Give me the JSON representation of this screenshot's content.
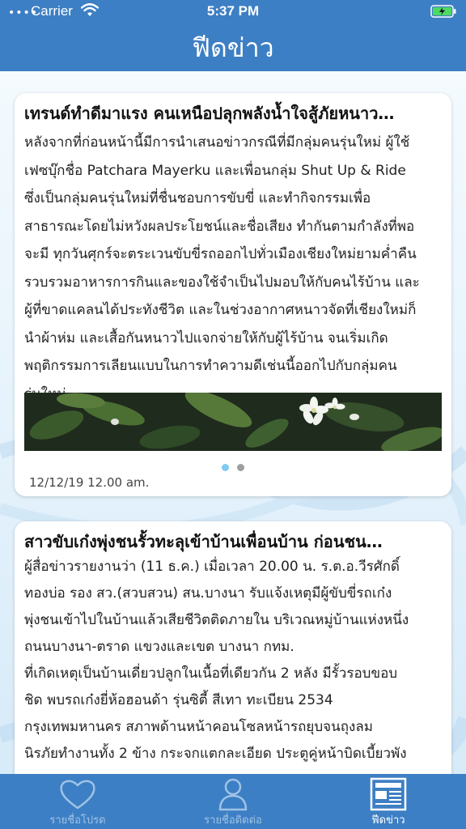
{
  "status_bar": {
    "carrier": "Carrier",
    "time": "5:37 PM",
    "wifi_icon": "wifi-icon",
    "battery_icon": "battery-charging-icon"
  },
  "nav": {
    "title": "ฟีดข่าว"
  },
  "feed": [
    {
      "title": "เทรนด์ทำดีมาแรง คนเหนือปลุกพลังน้ำใจสู้ภัยหนาว…",
      "body": "หลังจากที่ก่อนหน้านี้มีการนำเสนอข่าวกรณีที่มีกลุ่มคนรุ่นใหม่ ผู้ใช้\nเฟซบุ๊กชื่อ Patchara Mayerku และเพื่อนกลุ่ม Shut Up & Ride\nซึ่งเป็นกลุ่มคนรุ่นใหม่ที่ชื่นชอบการขับขี่ และทำกิจกรรมเพื่อ\nสาธารณะโดยไม่หวังผลประโยชน์และชื่อเสียง ทำกันตามกำลังที่พอ\nจะมี ทุกวันศุกร์จะตระเวนขับขี่รถออกไปทั่วเมืองเชียงใหม่ยามค่ำคืน\nรวบรวมอาหารการกินและของใช้จำเป็นไปมอบให้กับคนไร้บ้าน และ\nผู้ที่ขาดแคลนได้ประทังชีวิต และในช่วงอากาศหนาวจัดที่เชียงใหม่ก็\nนำผ้าห่ม และเสื้อกันหนาวไปแจกจ่ายให้กับผู้ไร้บ้าน จนเริ่มเกิด\nพฤติกรรมการเลียนแบบในการทำความดีเช่นนี้ออกไปกับกลุ่มคน\nรุ่นใหม่",
      "image": "white-flowers-photo",
      "pager": {
        "count": 2,
        "active": 1
      },
      "date": "12/12/19 12.00 am."
    },
    {
      "title": "สาวขับเก๋งพุ่งชนรั้วทะลุเข้าบ้านเพื่อนบ้าน ก่อนชน…",
      "body": "ผู้สื่อข่าวรายงานว่า (11 ธ.ค.) เมื่อเวลา 20.00 น. ร.ต.อ.วีรศักดิ์\nทองบ่อ รอง สว.(สวบสวน) สน.บางนา รับแจ้งเหตุมีผู้ขับขี่รถเก๋ง\nพุ่งชนเข้าไปในบ้านแล้วเสียชีวิตติดภายใน บริเวณหมู่บ้านแห่งหนึ่ง\nถนนบางนา-ตราด แขวงและเขต บางนา กทม.\nที่เกิดเหตุเป็นบ้านเดี่ยวปลูกในเนื้อที่เดียวกัน 2 หลัง มีรั้วรอบขอบ\nชิด พบรถเก๋งยี่ห้อฮอนด้า รุ่นซิตี้ สีเทา ทะเบียน 2534\nกรุงเทพมหานคร สภาพด้านหน้าคอนโซลหน้ารถยุบจนถุงลม\nนิรภัยทำงานทั้ง 2 ข้าง กระจกแตกละเอียด ประตูคู่หน้าบิดเบี้ยวพัง"
    }
  ],
  "tabs": [
    {
      "label": "รายชื่อโปรด",
      "icon": "heart-icon",
      "active": false
    },
    {
      "label": "รายชื่อติดต่อ",
      "icon": "person-icon",
      "active": false
    },
    {
      "label": "ฟีดข่าว",
      "icon": "newspaper-icon",
      "active": true
    }
  ],
  "colors": {
    "primary": "#3d7fc4",
    "tab_inactive": "#9ec3e6",
    "pager_active": "#7ecbef",
    "pager_inactive": "#9e9e9e"
  }
}
